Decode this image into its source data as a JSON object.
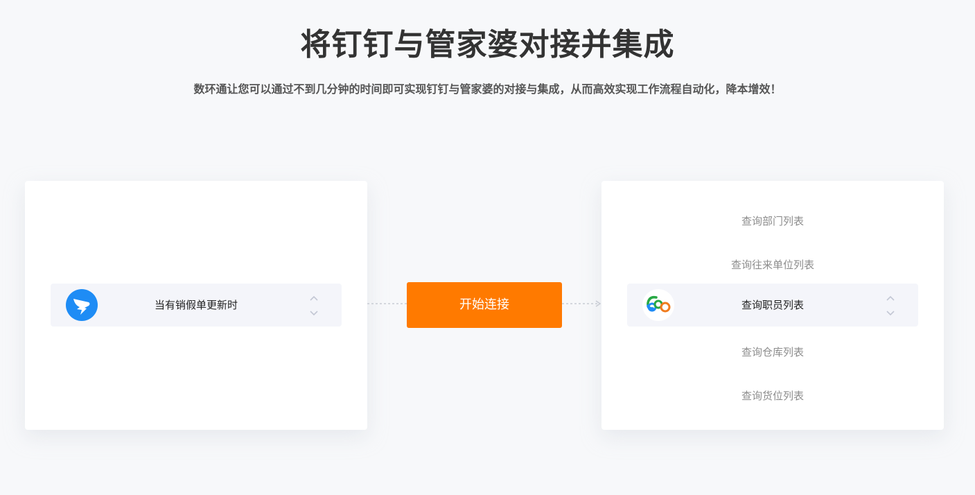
{
  "header": {
    "title": "将钉钉与管家婆对接并集成",
    "subtitle": "数环通让您可以通过不到几分钟的时间即可实现钉钉与管家婆的对接与集成，从而高效实现工作流程自动化，降本增效！"
  },
  "trigger_card": {
    "app_icon": "dingtalk-logo",
    "selected_trigger": "当有销假单更新时"
  },
  "connect": {
    "button_label": "开始连接"
  },
  "action_card": {
    "app_icon": "guanjiapo-logo",
    "options_above": [
      "查询部门列表",
      "查询往来单位列表"
    ],
    "selected_action": "查询职员列表",
    "options_below": [
      "查询仓库列表",
      "查询货位列表"
    ]
  },
  "colors": {
    "accent": "#ff7a00",
    "dingtalk_blue": "#1e8cf5",
    "background": "#f7f8fa"
  }
}
